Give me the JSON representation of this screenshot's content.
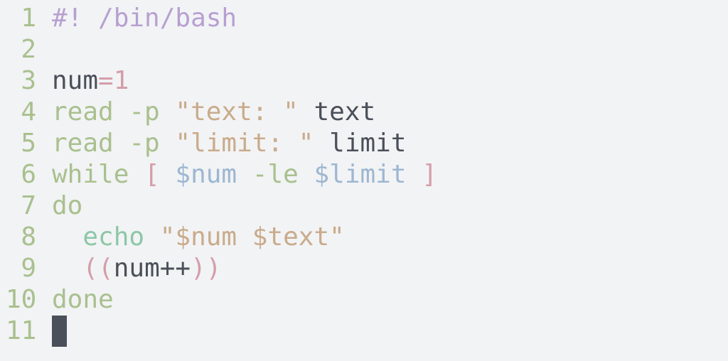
{
  "colors": {
    "background": "#f2f3f5",
    "line_number": "#a9c08e",
    "shebang": "#b7a0d1",
    "keyword": "#a9c08e",
    "builtin_echo": "#8cc7a7",
    "string": "#c9ab8b",
    "variable": "#9db7d1",
    "operator": "#d49ea9",
    "plain": "#4a5059",
    "cursor": "#4a5059"
  },
  "editor": {
    "lines": [
      {
        "number": "1",
        "tokens": [
          {
            "text": "#! /bin/bash",
            "color": "#b7a0d1"
          }
        ]
      },
      {
        "number": "2",
        "tokens": []
      },
      {
        "number": "3",
        "tokens": [
          {
            "text": "num",
            "color": "#4a5059"
          },
          {
            "text": "=",
            "color": "#d49ea9"
          },
          {
            "text": "1",
            "color": "#d49ea9"
          }
        ]
      },
      {
        "number": "4",
        "tokens": [
          {
            "text": "read -p ",
            "color": "#a9c08e"
          },
          {
            "text": "\"text: \"",
            "color": "#c9ab8b"
          },
          {
            "text": " text",
            "color": "#4a5059"
          }
        ]
      },
      {
        "number": "5",
        "tokens": [
          {
            "text": "read -p ",
            "color": "#a9c08e"
          },
          {
            "text": "\"limit: \"",
            "color": "#c9ab8b"
          },
          {
            "text": " limit",
            "color": "#4a5059"
          }
        ]
      },
      {
        "number": "6",
        "tokens": [
          {
            "text": "while ",
            "color": "#a9c08e"
          },
          {
            "text": "[ ",
            "color": "#d49ea9"
          },
          {
            "text": "$num ",
            "color": "#9db7d1"
          },
          {
            "text": "-le ",
            "color": "#a9c08e"
          },
          {
            "text": "$limit ",
            "color": "#9db7d1"
          },
          {
            "text": "]",
            "color": "#d49ea9"
          }
        ]
      },
      {
        "number": "7",
        "tokens": [
          {
            "text": "do",
            "color": "#a9c08e"
          }
        ]
      },
      {
        "number": "8",
        "tokens": [
          {
            "text": "  ",
            "color": "#4a5059"
          },
          {
            "text": "echo ",
            "color": "#8cc7a7"
          },
          {
            "text": "\"$num $text\"",
            "color": "#c9ab8b"
          }
        ]
      },
      {
        "number": "9",
        "tokens": [
          {
            "text": "  ",
            "color": "#4a5059"
          },
          {
            "text": "((",
            "color": "#d49ea9"
          },
          {
            "text": "num++",
            "color": "#4a5059"
          },
          {
            "text": "))",
            "color": "#d49ea9"
          }
        ]
      },
      {
        "number": "10",
        "tokens": [
          {
            "text": "done",
            "color": "#a9c08e"
          }
        ]
      },
      {
        "number": "11",
        "tokens": [],
        "cursor": true
      }
    ]
  }
}
